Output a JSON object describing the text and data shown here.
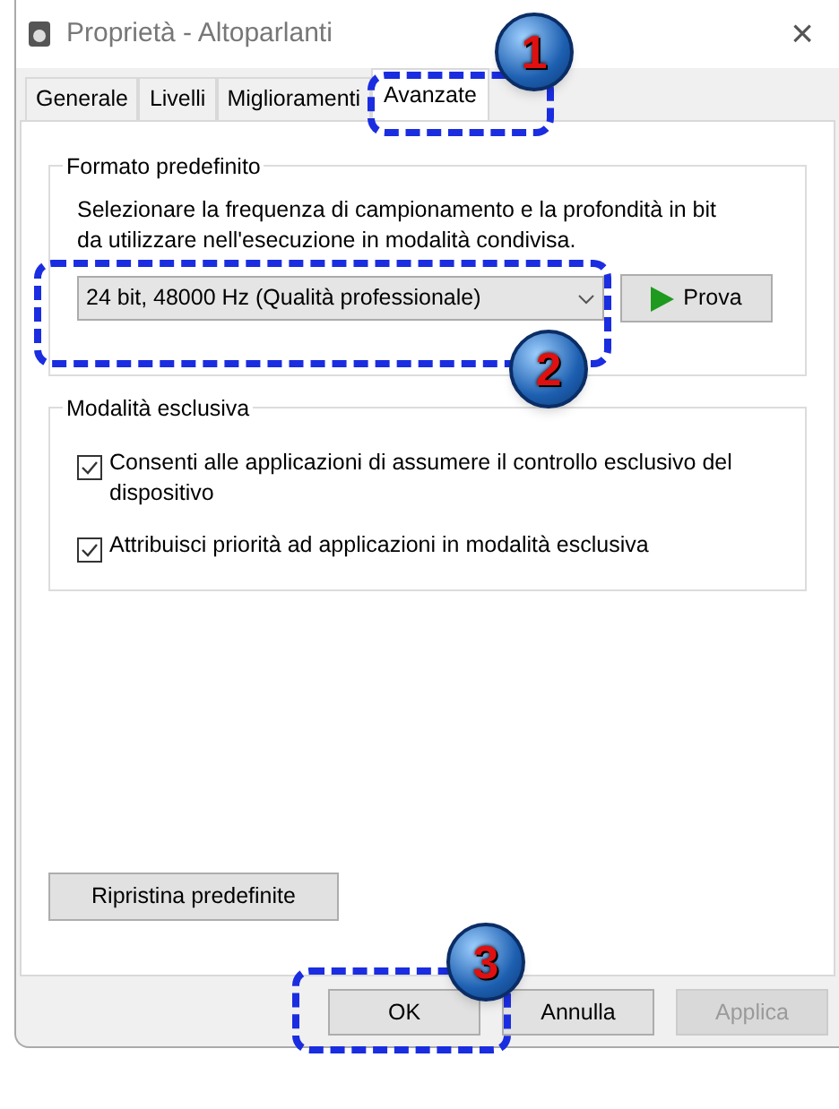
{
  "window": {
    "title": "Proprietà - Altoparlanti",
    "close": "×"
  },
  "tabs": [
    {
      "label": "Generale",
      "selected": false
    },
    {
      "label": "Livelli",
      "selected": false
    },
    {
      "label": "Miglioramenti",
      "selected": false
    },
    {
      "label": "Avanzate",
      "selected": true
    }
  ],
  "default_format": {
    "title": "Formato predefinito",
    "description": "Selezionare la frequenza di campionamento e la profondità in bit da utilizzare nell'esecuzione in modalità condivisa.",
    "value": "24 bit, 48000 Hz (Qualità professionale)",
    "test_button": "Prova"
  },
  "exclusive_mode": {
    "title": "Modalità esclusiva",
    "options": [
      {
        "label": "Consenti alle applicazioni di assumere il controllo esclusivo del dispositivo",
        "checked": true
      },
      {
        "label": "Attribuisci priorità ad applicazioni in modalità esclusiva",
        "checked": true
      }
    ]
  },
  "restore_button": "Ripristina predefinite",
  "buttons": [
    {
      "label": "OK",
      "disabled": false
    },
    {
      "label": "Annulla",
      "disabled": false
    },
    {
      "label": "Applica",
      "disabled": true
    }
  ],
  "callouts": [
    "1",
    "2",
    "3"
  ]
}
